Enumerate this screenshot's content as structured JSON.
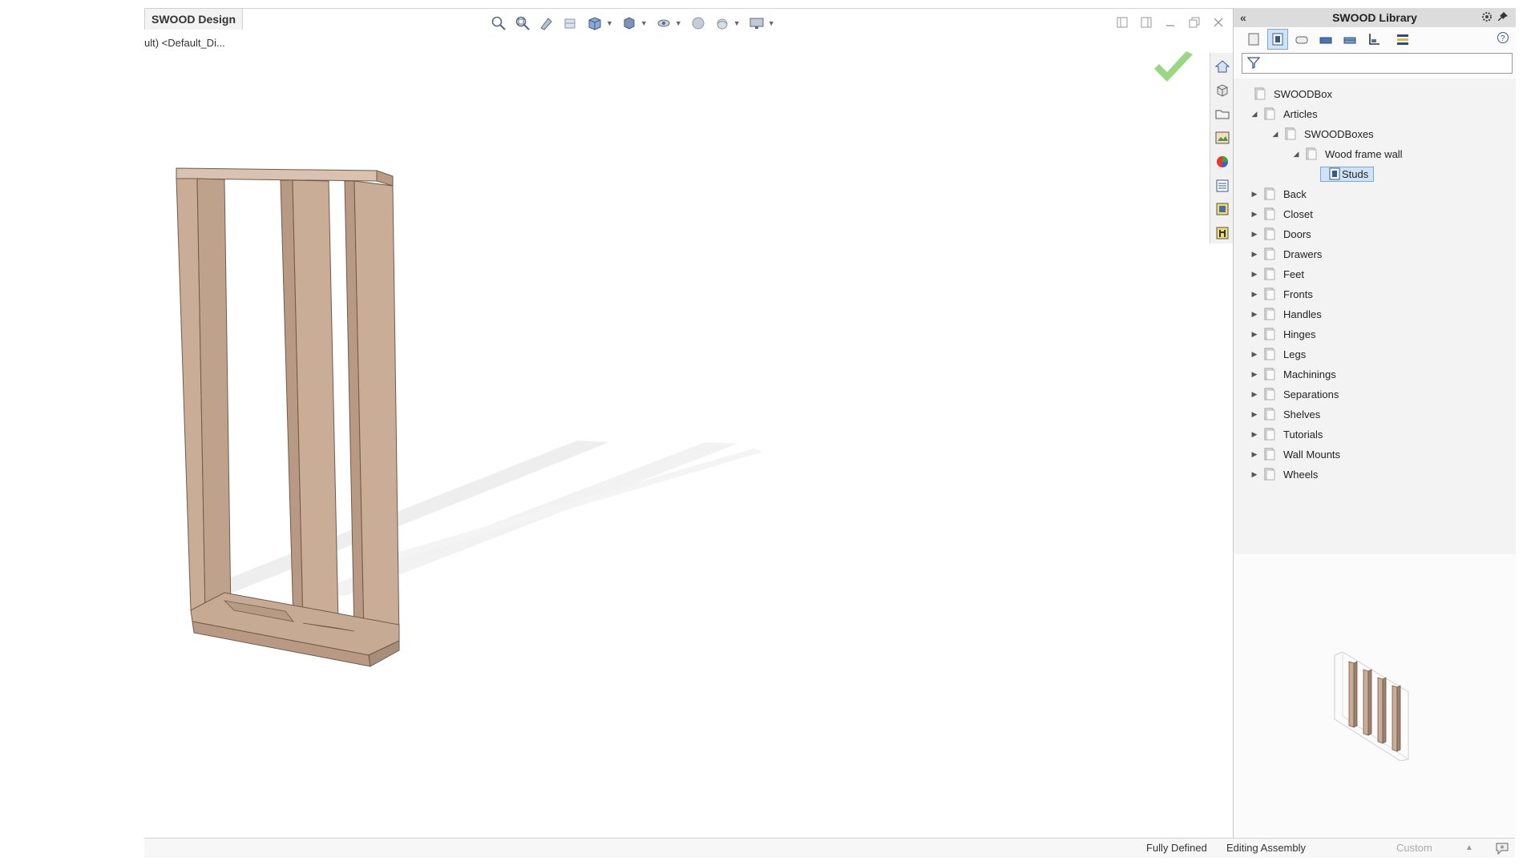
{
  "document": {
    "tab_title": "SWOOD Design",
    "config_text": "ult) <Default_Di..."
  },
  "heads_up_toolbar": {
    "icons": [
      "zoom-to-fit-icon",
      "zoom-to-area-icon",
      "previous-view-icon",
      "section-view-icon",
      "view-orientation-icon",
      "display-style-icon",
      "hide-show-icon",
      "edit-appearance-icon",
      "apply-scene-icon",
      "view-settings-icon"
    ]
  },
  "panel": {
    "title": "SWOOD Library",
    "toolbar_icons": [
      "article-icon",
      "box-icon",
      "panel-icon",
      "door-icon",
      "drawer-icon",
      "dimension-icon",
      "layers-icon"
    ],
    "tree": {
      "root": "SWOODBox",
      "articles": "Articles",
      "swoodboxes": "SWOODBoxes",
      "wood_frame_wall": "Wood frame wall",
      "selected": "Studs",
      "categories": [
        "Back",
        "Closet",
        "Doors",
        "Drawers",
        "Feet",
        "Fronts",
        "Handles",
        "Hinges",
        "Legs",
        "Machinings",
        "Separations",
        "Shelves",
        "Tutorials",
        "Wall Mounts",
        "Wheels"
      ]
    }
  },
  "task_pane_icons": [
    "home-icon",
    "3d-content-icon",
    "file-explorer-icon",
    "view-palette-icon",
    "appearances-icon",
    "custom-properties-icon",
    "swood-library-icon",
    "swood-tools-icon"
  ],
  "statusbar": {
    "state": "Fully Defined",
    "mode": "Editing Assembly",
    "units": "Custom"
  },
  "colors": {
    "wood": "#c9ad96",
    "wood_dark": "#8f7462",
    "accent_check": "#6cc24a",
    "selection": "#cfe3f7"
  }
}
